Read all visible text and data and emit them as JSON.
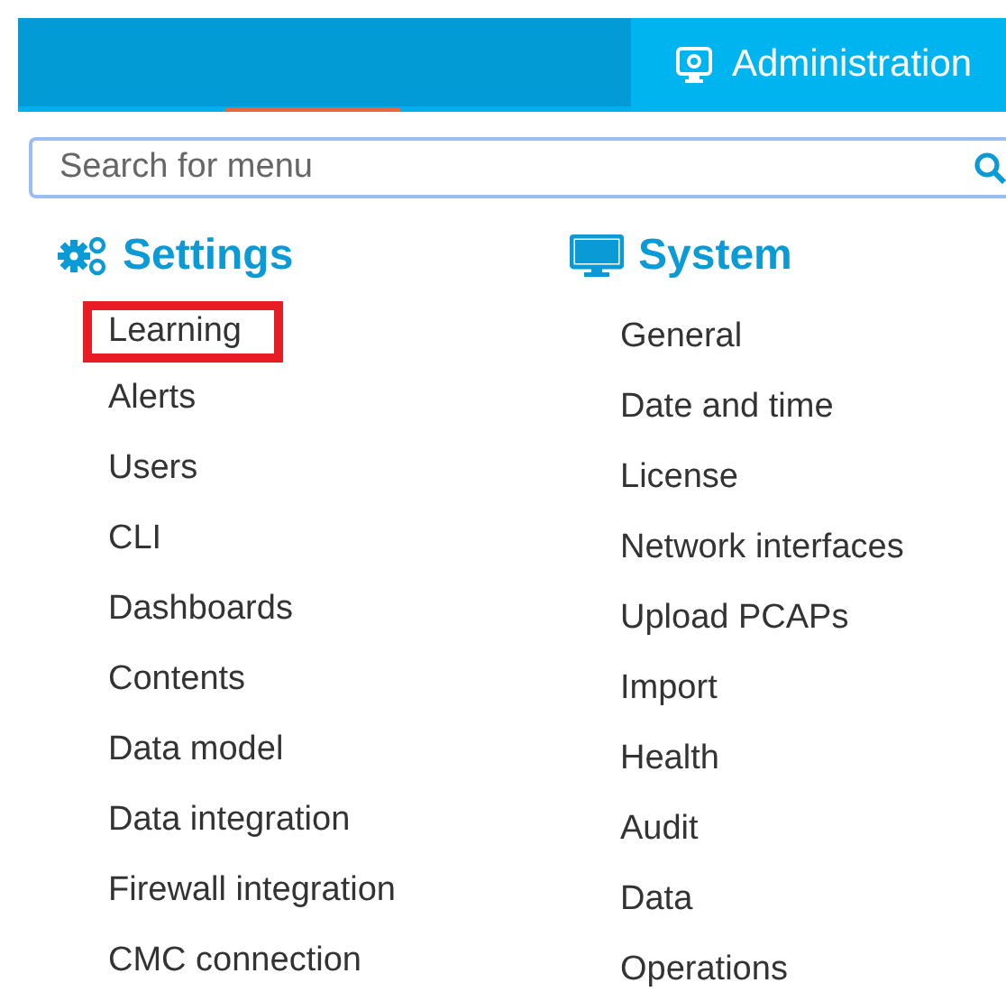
{
  "top_bar": {
    "admin_label": "Administration"
  },
  "search": {
    "placeholder": "Search for menu"
  },
  "sections": [
    {
      "title": "Settings",
      "kind": "gears",
      "items": [
        {
          "label": "Learning",
          "highlighted": true
        },
        {
          "label": "Alerts",
          "highlighted": false
        },
        {
          "label": "Users",
          "highlighted": false
        },
        {
          "label": "CLI",
          "highlighted": false
        },
        {
          "label": "Dashboards",
          "highlighted": false
        },
        {
          "label": "Contents",
          "highlighted": false
        },
        {
          "label": "Data model",
          "highlighted": false
        },
        {
          "label": "Data integration",
          "highlighted": false
        },
        {
          "label": "Firewall integration",
          "highlighted": false
        },
        {
          "label": "CMC connection",
          "highlighted": false
        }
      ]
    },
    {
      "title": "System",
      "kind": "monitor",
      "items": [
        {
          "label": "General",
          "highlighted": false
        },
        {
          "label": "Date and time",
          "highlighted": false
        },
        {
          "label": "License",
          "highlighted": false
        },
        {
          "label": "Network interfaces",
          "highlighted": false
        },
        {
          "label": "Upload PCAPs",
          "highlighted": false
        },
        {
          "label": "Import",
          "highlighted": false
        },
        {
          "label": "Health",
          "highlighted": false
        },
        {
          "label": "Audit",
          "highlighted": false
        },
        {
          "label": "Data",
          "highlighted": false
        },
        {
          "label": "Operations",
          "highlighted": false
        }
      ]
    }
  ]
}
